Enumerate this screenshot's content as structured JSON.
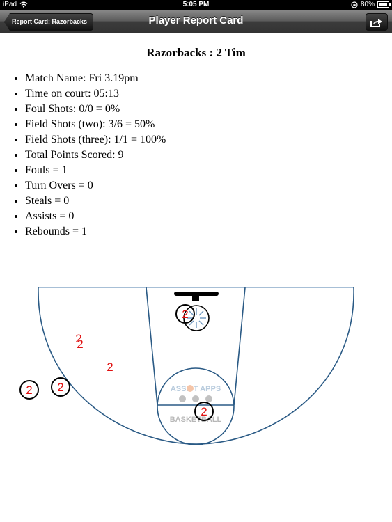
{
  "statusbar": {
    "device": "iPad",
    "time": "5:05 PM",
    "battery": "80%",
    "battery_level": 0.8
  },
  "navbar": {
    "back_label": "Report Card: Razorbacks",
    "title": "Player Report Card",
    "share_icon": "share-icon"
  },
  "report": {
    "heading": "Razorbacks : 2 Tim",
    "stats": [
      "Match Name: Fri 3.19pm",
      "Time on court: 05:13",
      "Foul Shots: 0/0 = 0%",
      "Field Shots (two): 3/6 = 50%",
      "Field Shots (three): 1/1 = 100%",
      "Total Points Scored: 9",
      "Fouls = 1",
      "Turn Overs = 0",
      "Steals = 0",
      "Assists = 0",
      "Rebounds = 1"
    ]
  },
  "court": {
    "line_color": "#2a5a85",
    "marker_color": "#e01010",
    "circle_color": "#000000",
    "logo_top": "ASSIST APPS",
    "logo_bottom": "BASKETBALL",
    "shots": [
      {
        "label": "2",
        "circled": true
      },
      {
        "label": "2",
        "circled": false
      },
      {
        "label": "2",
        "circled": false
      },
      {
        "label": "2",
        "circled": false
      },
      {
        "label": "2",
        "circled": true
      },
      {
        "label": "2",
        "circled": true
      },
      {
        "label": "2",
        "circled": true
      }
    ]
  }
}
